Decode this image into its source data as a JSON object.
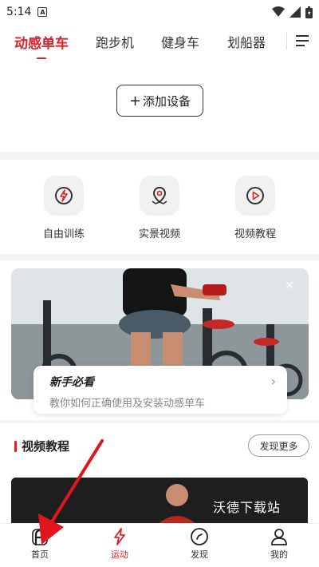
{
  "status": {
    "time": "5:14",
    "badge": "A"
  },
  "tabs": [
    {
      "label": "动感单车",
      "active": true
    },
    {
      "label": "跑步机"
    },
    {
      "label": "健身车"
    },
    {
      "label": "划船器"
    }
  ],
  "device": {
    "add_label": "添加设备"
  },
  "features": [
    {
      "label": "自由训练",
      "icon": "lightning-circle-icon"
    },
    {
      "label": "实景视频",
      "icon": "map-pin-icon"
    },
    {
      "label": "视频教程",
      "icon": "play-circle-icon"
    }
  ],
  "guide": {
    "title": "新手必看",
    "subtitle": "教你如何正确使用及安装动感单车"
  },
  "video": {
    "section_title": "视频教程",
    "more_label": "发现更多",
    "watermark": "沃德下载站"
  },
  "nav": [
    {
      "label": "首页",
      "icon": "home-f-icon"
    },
    {
      "label": "运动",
      "icon": "bolt-icon",
      "active": true
    },
    {
      "label": "发现",
      "icon": "compass-icon"
    },
    {
      "label": "我的",
      "icon": "user-icon"
    }
  ],
  "colors": {
    "accent": "#d8232a",
    "arrow": "#e0161c"
  }
}
